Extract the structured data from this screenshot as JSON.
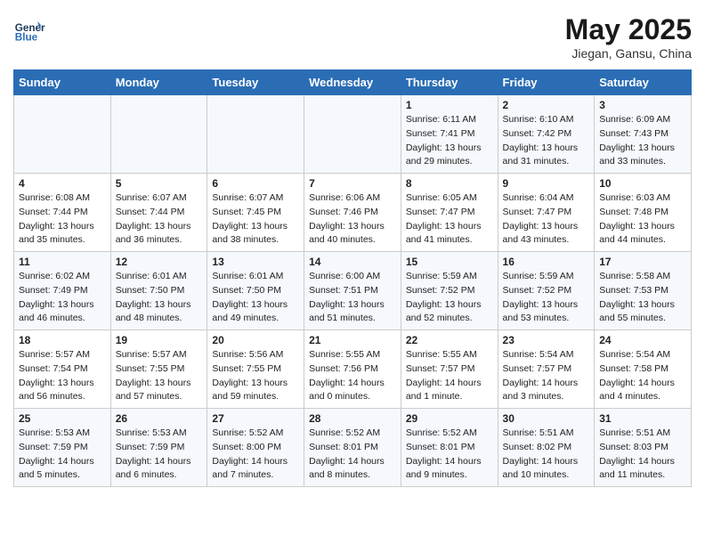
{
  "header": {
    "logo_line1": "General",
    "logo_line2": "Blue",
    "title": "May 2025",
    "subtitle": "Jiegan, Gansu, China"
  },
  "days_of_week": [
    "Sunday",
    "Monday",
    "Tuesday",
    "Wednesday",
    "Thursday",
    "Friday",
    "Saturday"
  ],
  "weeks": [
    [
      {
        "day": "",
        "info": ""
      },
      {
        "day": "",
        "info": ""
      },
      {
        "day": "",
        "info": ""
      },
      {
        "day": "",
        "info": ""
      },
      {
        "day": "1",
        "info": "Sunrise: 6:11 AM\nSunset: 7:41 PM\nDaylight: 13 hours\nand 29 minutes."
      },
      {
        "day": "2",
        "info": "Sunrise: 6:10 AM\nSunset: 7:42 PM\nDaylight: 13 hours\nand 31 minutes."
      },
      {
        "day": "3",
        "info": "Sunrise: 6:09 AM\nSunset: 7:43 PM\nDaylight: 13 hours\nand 33 minutes."
      }
    ],
    [
      {
        "day": "4",
        "info": "Sunrise: 6:08 AM\nSunset: 7:44 PM\nDaylight: 13 hours\nand 35 minutes."
      },
      {
        "day": "5",
        "info": "Sunrise: 6:07 AM\nSunset: 7:44 PM\nDaylight: 13 hours\nand 36 minutes."
      },
      {
        "day": "6",
        "info": "Sunrise: 6:07 AM\nSunset: 7:45 PM\nDaylight: 13 hours\nand 38 minutes."
      },
      {
        "day": "7",
        "info": "Sunrise: 6:06 AM\nSunset: 7:46 PM\nDaylight: 13 hours\nand 40 minutes."
      },
      {
        "day": "8",
        "info": "Sunrise: 6:05 AM\nSunset: 7:47 PM\nDaylight: 13 hours\nand 41 minutes."
      },
      {
        "day": "9",
        "info": "Sunrise: 6:04 AM\nSunset: 7:47 PM\nDaylight: 13 hours\nand 43 minutes."
      },
      {
        "day": "10",
        "info": "Sunrise: 6:03 AM\nSunset: 7:48 PM\nDaylight: 13 hours\nand 44 minutes."
      }
    ],
    [
      {
        "day": "11",
        "info": "Sunrise: 6:02 AM\nSunset: 7:49 PM\nDaylight: 13 hours\nand 46 minutes."
      },
      {
        "day": "12",
        "info": "Sunrise: 6:01 AM\nSunset: 7:50 PM\nDaylight: 13 hours\nand 48 minutes."
      },
      {
        "day": "13",
        "info": "Sunrise: 6:01 AM\nSunset: 7:50 PM\nDaylight: 13 hours\nand 49 minutes."
      },
      {
        "day": "14",
        "info": "Sunrise: 6:00 AM\nSunset: 7:51 PM\nDaylight: 13 hours\nand 51 minutes."
      },
      {
        "day": "15",
        "info": "Sunrise: 5:59 AM\nSunset: 7:52 PM\nDaylight: 13 hours\nand 52 minutes."
      },
      {
        "day": "16",
        "info": "Sunrise: 5:59 AM\nSunset: 7:52 PM\nDaylight: 13 hours\nand 53 minutes."
      },
      {
        "day": "17",
        "info": "Sunrise: 5:58 AM\nSunset: 7:53 PM\nDaylight: 13 hours\nand 55 minutes."
      }
    ],
    [
      {
        "day": "18",
        "info": "Sunrise: 5:57 AM\nSunset: 7:54 PM\nDaylight: 13 hours\nand 56 minutes."
      },
      {
        "day": "19",
        "info": "Sunrise: 5:57 AM\nSunset: 7:55 PM\nDaylight: 13 hours\nand 57 minutes."
      },
      {
        "day": "20",
        "info": "Sunrise: 5:56 AM\nSunset: 7:55 PM\nDaylight: 13 hours\nand 59 minutes."
      },
      {
        "day": "21",
        "info": "Sunrise: 5:55 AM\nSunset: 7:56 PM\nDaylight: 14 hours\nand 0 minutes."
      },
      {
        "day": "22",
        "info": "Sunrise: 5:55 AM\nSunset: 7:57 PM\nDaylight: 14 hours\nand 1 minute."
      },
      {
        "day": "23",
        "info": "Sunrise: 5:54 AM\nSunset: 7:57 PM\nDaylight: 14 hours\nand 3 minutes."
      },
      {
        "day": "24",
        "info": "Sunrise: 5:54 AM\nSunset: 7:58 PM\nDaylight: 14 hours\nand 4 minutes."
      }
    ],
    [
      {
        "day": "25",
        "info": "Sunrise: 5:53 AM\nSunset: 7:59 PM\nDaylight: 14 hours\nand 5 minutes."
      },
      {
        "day": "26",
        "info": "Sunrise: 5:53 AM\nSunset: 7:59 PM\nDaylight: 14 hours\nand 6 minutes."
      },
      {
        "day": "27",
        "info": "Sunrise: 5:52 AM\nSunset: 8:00 PM\nDaylight: 14 hours\nand 7 minutes."
      },
      {
        "day": "28",
        "info": "Sunrise: 5:52 AM\nSunset: 8:01 PM\nDaylight: 14 hours\nand 8 minutes."
      },
      {
        "day": "29",
        "info": "Sunrise: 5:52 AM\nSunset: 8:01 PM\nDaylight: 14 hours\nand 9 minutes."
      },
      {
        "day": "30",
        "info": "Sunrise: 5:51 AM\nSunset: 8:02 PM\nDaylight: 14 hours\nand 10 minutes."
      },
      {
        "day": "31",
        "info": "Sunrise: 5:51 AM\nSunset: 8:03 PM\nDaylight: 14 hours\nand 11 minutes."
      }
    ]
  ]
}
